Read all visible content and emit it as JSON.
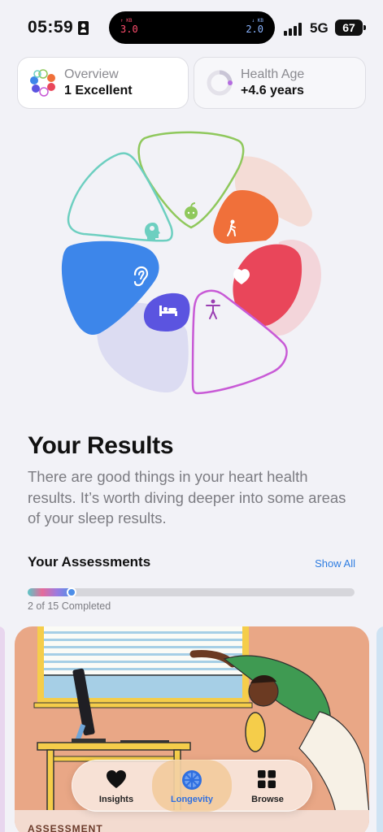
{
  "status_bar": {
    "time": "05:59",
    "upload_unit": "↑ KB",
    "upload_value": "3.0",
    "download_unit": "↓ KB",
    "download_value": "2.0",
    "network_type": "5G",
    "battery": "67"
  },
  "summary_cards": {
    "overview": {
      "label": "Overview",
      "value": "1 Excellent"
    },
    "health_age": {
      "label": "Health Age",
      "value": "+4.6 years"
    }
  },
  "flower": {
    "petals": [
      {
        "name": "nutrition",
        "icon": "apple-icon",
        "color": "#8fc85c",
        "style": "outline"
      },
      {
        "name": "activity",
        "icon": "walking-icon",
        "color": "#f0703a",
        "style": "filled"
      },
      {
        "name": "heart",
        "icon": "heart-icon",
        "color": "#e9465a",
        "style": "filled"
      },
      {
        "name": "mobility",
        "icon": "person-arms-icon",
        "color": "#c85ad6",
        "style": "outline"
      },
      {
        "name": "sleep",
        "icon": "bed-icon",
        "color": "#5b54e0",
        "style": "filled"
      },
      {
        "name": "hearing",
        "icon": "ear-icon",
        "color": "#3d86ea",
        "style": "filled"
      },
      {
        "name": "mind",
        "icon": "brain-head-icon",
        "color": "#6dcfc0",
        "style": "outline"
      }
    ]
  },
  "results": {
    "title": "Your Results",
    "text": "There are good things in your heart health results. It’s worth diving deeper into some areas of your sleep results."
  },
  "assessments": {
    "title": "Your Assessments",
    "show_all": "Show All",
    "completed": 2,
    "total": 15,
    "progress_text": "2 of 15 Completed",
    "card_label": "ASSESSMENT"
  },
  "tab_bar": {
    "tabs": [
      {
        "label": "Insights",
        "icon": "heart-icon",
        "active": false
      },
      {
        "label": "Longevity",
        "icon": "citrus-icon",
        "active": true
      },
      {
        "label": "Browse",
        "icon": "grid-icon",
        "active": false
      }
    ]
  }
}
